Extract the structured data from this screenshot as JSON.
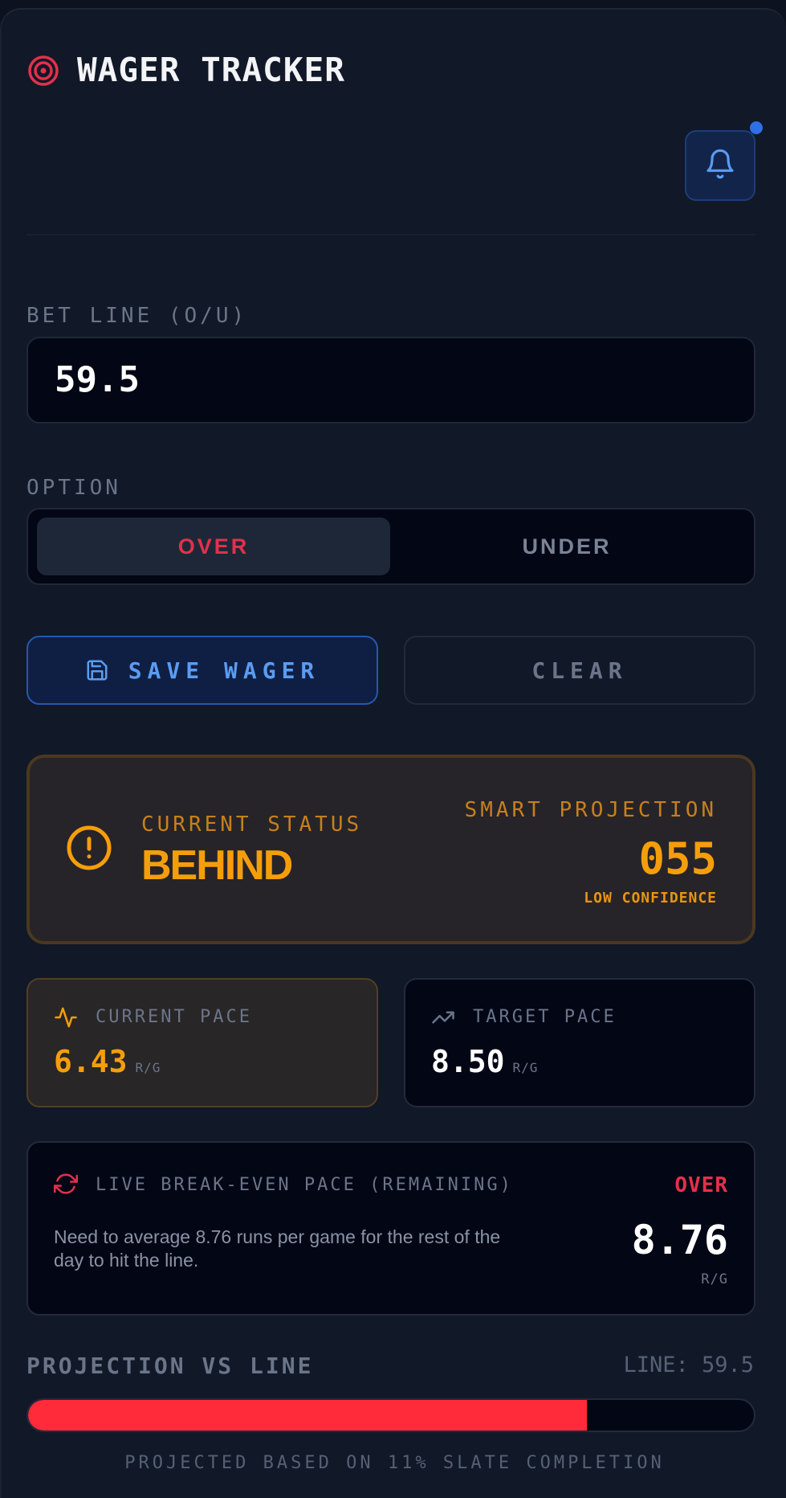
{
  "header": {
    "title": "WAGER TRACKER",
    "title_icon": "target-icon",
    "notification_icon": "bell-icon",
    "has_notification": true
  },
  "form": {
    "bet_line_label": "BET LINE (O/U)",
    "bet_line_value": "59.5",
    "option_label": "OPTION",
    "options": [
      "OVER",
      "UNDER"
    ],
    "selected_option": "OVER",
    "save_label": "SAVE WAGER",
    "save_icon": "save-icon",
    "clear_label": "CLEAR"
  },
  "status": {
    "label": "CURRENT STATUS",
    "value": "BEHIND",
    "icon": "alert-circle-icon",
    "projection_label": "SMART PROJECTION",
    "projection_value": "055",
    "confidence": "LOW CONFIDENCE"
  },
  "pace": {
    "current": {
      "label": "CURRENT PACE",
      "value": "6.43",
      "unit": "R/G",
      "icon": "activity-icon"
    },
    "target": {
      "label": "TARGET PACE",
      "value": "8.50",
      "unit": "R/G",
      "icon": "trending-up-icon"
    }
  },
  "break_even": {
    "label": "LIVE BREAK-EVEN PACE (REMAINING)",
    "side": "OVER",
    "description": "Need to average 8.76 runs per game for the rest of the day to hit the line.",
    "value": "8.76",
    "unit": "R/G",
    "icon": "refresh-icon"
  },
  "projection_bar": {
    "title": "PROJECTION VS LINE",
    "line_text": "LINE: 59.5",
    "fill_fraction": 0.77,
    "footnote": "PROJECTED BASED ON 11% SLATE COMPLETION"
  },
  "colors": {
    "accent_red": "#e3304b",
    "accent_amber": "#f59e0b",
    "accent_blue": "#5b9cf1",
    "bar_fill": "#ff2a3a"
  }
}
